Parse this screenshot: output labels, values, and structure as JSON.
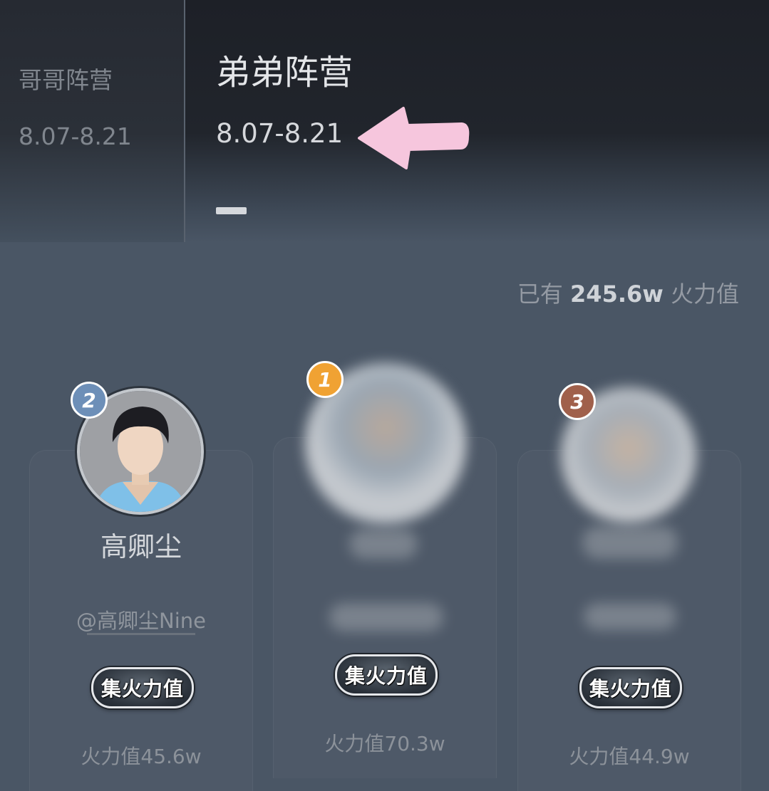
{
  "tabs": [
    {
      "name": "哥哥阵营",
      "dates": "8.07-8.21"
    },
    {
      "name": "弟弟阵营",
      "dates": "8.07-8.21",
      "active": true
    }
  ],
  "summary": {
    "prefix": "已有",
    "value": "245.6w",
    "suffix": "火力值"
  },
  "ranking": {
    "first": {
      "rank": "1",
      "badge_color": "#f0a233",
      "name": "",
      "handle": "",
      "button": "集火力值",
      "fire": "火力值70.3w"
    },
    "second": {
      "rank": "2",
      "badge_color": "#6d8fb8",
      "name": "高卿尘",
      "handle": "@高卿尘Nine",
      "button": "集火力值",
      "fire": "火力值45.6w"
    },
    "third": {
      "rank": "3",
      "badge_color": "#a0604b",
      "name": "",
      "handle": "",
      "button": "集火力值",
      "fire": "火力值44.9w"
    }
  },
  "colors": {
    "annotation_arrow": "#f6c6dd",
    "background": "#4a5665"
  }
}
